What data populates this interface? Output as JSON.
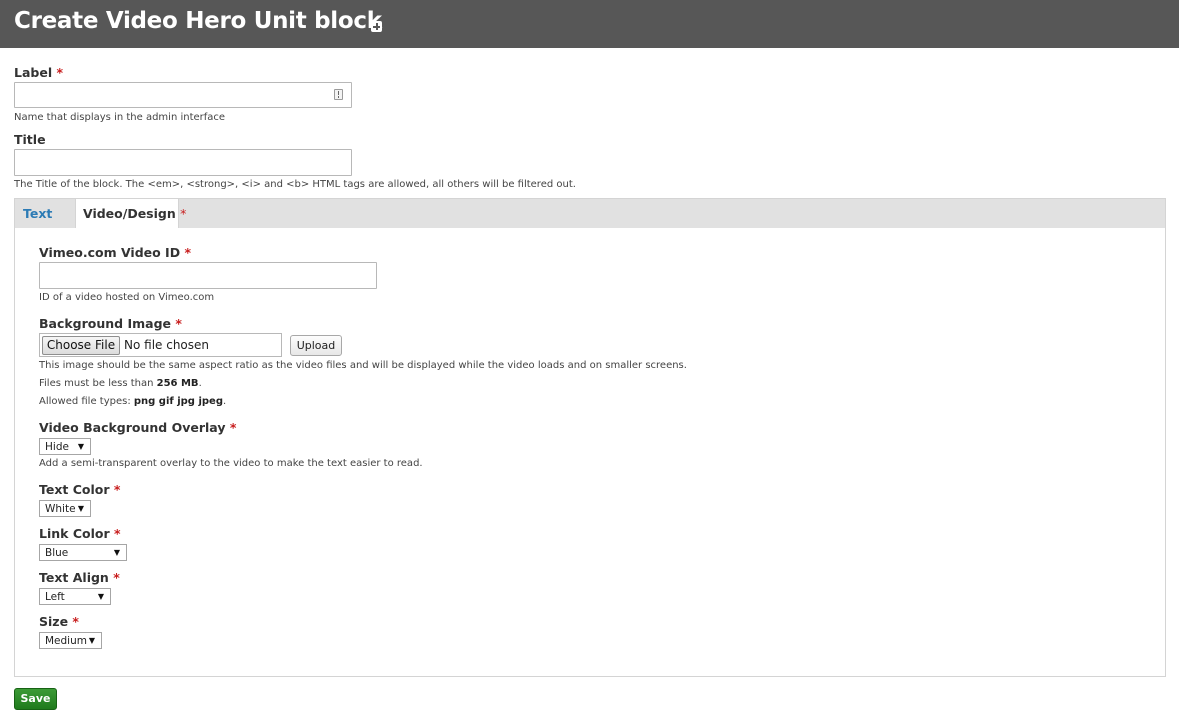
{
  "header": {
    "title": "Create Video Hero Unit block",
    "shortcut_icon": "plus-square-icon"
  },
  "label_field": {
    "label": "Label",
    "required_marker": "*",
    "value": "",
    "description": "Name that displays in the admin interface",
    "icon": "autofill-icon"
  },
  "title_field": {
    "label": "Title",
    "value": "",
    "description": "The Title of the block. The <em>, <strong>, <i> and <b> HTML tags are allowed, all others will be filtered out."
  },
  "tabs": [
    {
      "label": "Text",
      "active": false
    },
    {
      "label": "Video/Design",
      "required_marker": "*",
      "active": true
    }
  ],
  "vimeo": {
    "label": "Vimeo.com Video ID",
    "required_marker": "*",
    "value": "",
    "description": "ID of a video hosted on Vimeo.com"
  },
  "background_image": {
    "label": "Background Image",
    "required_marker": "*",
    "choose_button": "Choose File",
    "no_file_text": "No file chosen",
    "upload_button": "Upload",
    "description": "This image should be the same aspect ratio as the video files and will be displayed while the video loads and on smaller screens.",
    "size_prefix": "Files must be less than ",
    "size_value": "256 MB",
    "size_suffix": ".",
    "types_prefix": "Allowed file types: ",
    "types_value": "png gif jpg jpeg",
    "types_suffix": "."
  },
  "overlay": {
    "label": "Video Background Overlay",
    "required_marker": "*",
    "selected": "Hide",
    "description": "Add a semi-transparent overlay to the video to make the text easier to read."
  },
  "text_color": {
    "label": "Text Color",
    "required_marker": "*",
    "selected": "White"
  },
  "link_color": {
    "label": "Link Color",
    "required_marker": "*",
    "selected": "Blue"
  },
  "text_align": {
    "label": "Text Align",
    "required_marker": "*",
    "selected": "Left"
  },
  "size": {
    "label": "Size",
    "required_marker": "*",
    "selected": "Medium"
  },
  "actions": {
    "save_label": "Save"
  },
  "colors": {
    "header_bg": "#575757",
    "tab_link": "#2c7bb5",
    "required": "#c81d1d",
    "save_bg": "#2a8a25"
  }
}
